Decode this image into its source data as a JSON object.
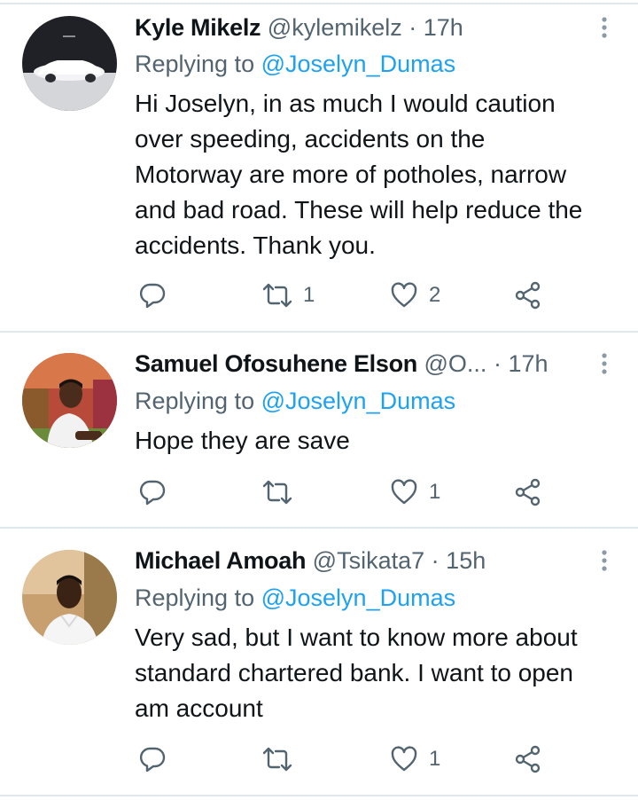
{
  "tweets": [
    {
      "display_name": "Kyle Mikelz",
      "handle": "@kylemikelz",
      "separator": "·",
      "time": "17h",
      "replying_prefix": "Replying to",
      "replying_to": "@Joselyn_Dumas",
      "text_lines": [
        "Hi Joselyn, in as much I would caution",
        "over speeding, accidents on the",
        "Motorway are more of potholes, narrow",
        "and bad road. These will help reduce the",
        "accidents. Thank you."
      ],
      "retweets": "1",
      "likes": "2"
    },
    {
      "display_name": "Samuel Ofosuhene Elson",
      "handle": "@O...",
      "separator": "·",
      "time": "17h",
      "replying_prefix": "Replying to",
      "replying_to": "@Joselyn_Dumas",
      "text_lines": [
        "Hope they are save"
      ],
      "retweets": "",
      "likes": "1"
    },
    {
      "display_name": "Michael Amoah",
      "handle": "@Tsikata7",
      "separator": "·",
      "time": "15h",
      "replying_prefix": "Replying to",
      "replying_to": "@Joselyn_Dumas",
      "text_lines": [
        "Very sad, but I want to know more about",
        "standard chartered bank. I want to open",
        "am account"
      ],
      "retweets": "",
      "likes": "1"
    }
  ],
  "colors": {
    "text": "#0f1419",
    "secondary": "#536471",
    "mention": "#1da1f2",
    "divider": "#e1e8ed"
  },
  "icons": {
    "reply": "reply-icon",
    "retweet": "retweet-icon",
    "like": "like-icon",
    "share": "share-icon",
    "more": "more-vertical-icon"
  }
}
